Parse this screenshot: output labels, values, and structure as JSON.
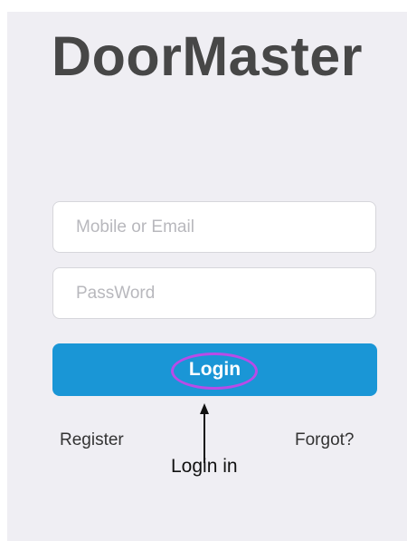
{
  "app": {
    "title": "DoorMaster"
  },
  "form": {
    "account_placeholder": "Mobile or Email",
    "account_value": "",
    "password_placeholder": "PassWord",
    "password_value": "",
    "login_label": "Login"
  },
  "links": {
    "register_label": "Register",
    "forgot_label": "Forgot?"
  },
  "annotation": {
    "label": "Login in",
    "highlight_color": "#b94be8",
    "arrow_icon": "arrow-up-icon"
  },
  "colors": {
    "background": "#efeef3",
    "primary_button": "#1a96d6",
    "title_text": "#474747"
  }
}
